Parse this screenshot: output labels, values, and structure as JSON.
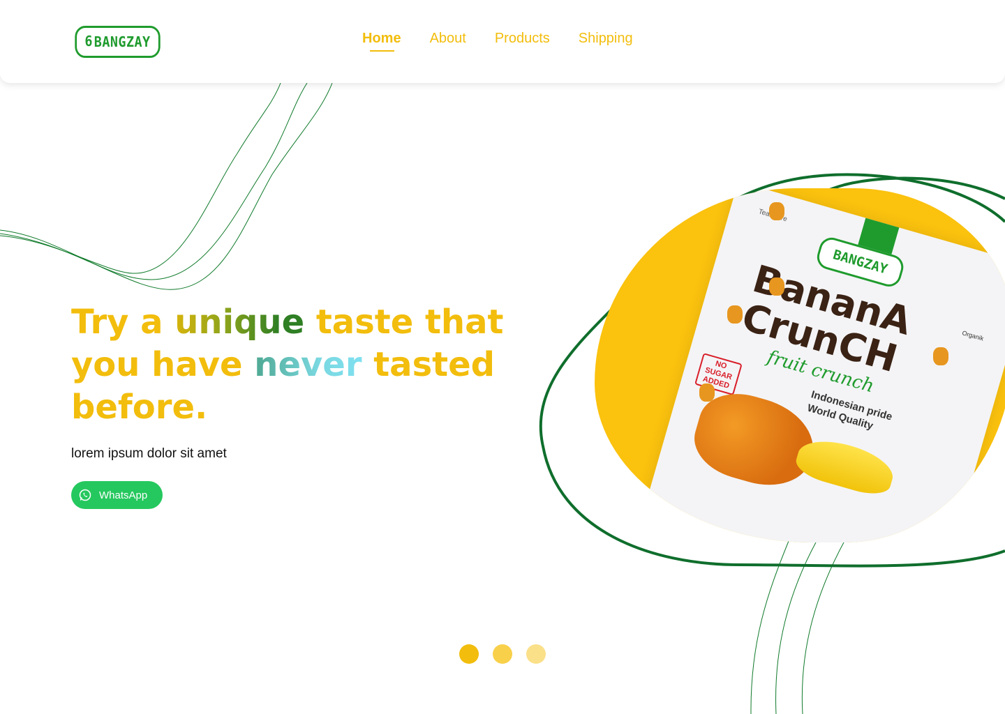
{
  "brand": {
    "name": "BANGZAY",
    "primary_color": "#f2bd0c",
    "accent_green": "#1f9b2d"
  },
  "nav": {
    "items": [
      {
        "label": "Home",
        "active": true
      },
      {
        "label": "About",
        "active": false
      },
      {
        "label": "Products",
        "active": false
      },
      {
        "label": "Shipping",
        "active": false
      }
    ]
  },
  "hero": {
    "title_part1": "Try a ",
    "title_unique": "unique",
    "title_part2": " taste that you have ",
    "title_never": "never",
    "title_part3": " tasted before.",
    "subtitle": "lorem ipsum dolor sit amet",
    "cta_label": "WhatsApp",
    "cta_icon": "whatsapp-icon",
    "cta_color": "#25c85e"
  },
  "product": {
    "pack_tear": "Tear here",
    "pack_brand": "BANGZAY",
    "pack_name_line1": "BananA",
    "pack_name_line2": "CrunCH",
    "pack_script": "fruit crunch",
    "pack_tagline_1": "Indonesian pride",
    "pack_tagline_2": "World Quality",
    "pack_badge": "NO SUGAR ADDED",
    "pack_organic": "Organik"
  },
  "carousel": {
    "dots": [
      {
        "color": "#f2bd0c",
        "active": true
      },
      {
        "color": "#f8d04a",
        "active": false
      },
      {
        "color": "#fbe08a",
        "active": false
      }
    ]
  }
}
